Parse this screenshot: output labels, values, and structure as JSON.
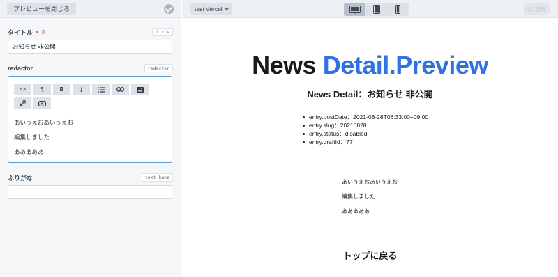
{
  "sidebar": {
    "close_preview_label": "プレビューを閉じる",
    "fields": {
      "title": {
        "label": "タイトル",
        "translit_hint": "あ",
        "handle": "title",
        "value": "お知らせ 非公開"
      },
      "redactor": {
        "label": "redactor",
        "handle": "redactor",
        "toolbar": [
          "<>",
          "¶",
          "B",
          "I",
          "list",
          "link",
          "image",
          "expand",
          "video"
        ],
        "lines": [
          "あいうえおあいうえお",
          "編集しました",
          "あああああ"
        ]
      },
      "furigana": {
        "label": "ふりがな",
        "handle": "text_kana",
        "value": ""
      }
    }
  },
  "preview_bar": {
    "target": "test Vercel",
    "devices": [
      "desktop",
      "tablet",
      "phone"
    ],
    "active_device": "desktop",
    "update_label": "更新"
  },
  "preview": {
    "heading_main": "News",
    "heading_accent": "Detail.Preview",
    "subheading": "News Detail：お知らせ 非公開",
    "meta": [
      "entry.postDate：2021-08-28T06:33:00+09:00",
      "entry.slug：20210828",
      "entry.status：disabled",
      "entry.draftId：77"
    ],
    "content_lines": [
      "あいうえおあいうえお",
      "編集しました",
      "あああああ"
    ],
    "back_link": "トップに戻る"
  },
  "colors": {
    "accent": "#2f73e0",
    "focus_border": "#5b9bd5",
    "required": "#f2663a"
  }
}
